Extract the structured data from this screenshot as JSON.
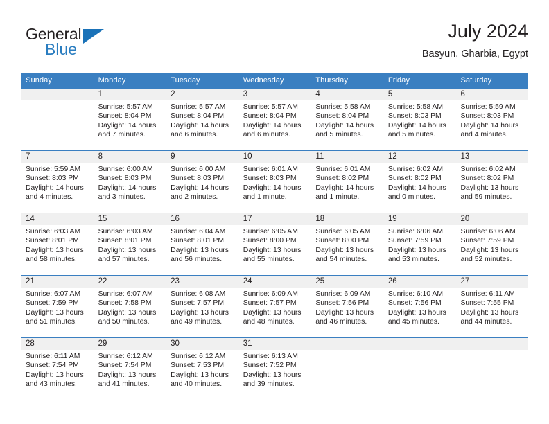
{
  "brand": {
    "name_part1": "General",
    "name_part2": "Blue",
    "triangle_color": "#1a72b8",
    "blue_color": "#2a7dc0"
  },
  "header": {
    "title": "July 2024",
    "subtitle": "Basyun, Gharbia, Egypt"
  },
  "theme": {
    "header_row_bg": "#3a7fc1",
    "date_band_bg": "#f0f0f0",
    "text_color": "#231f20"
  },
  "weekdays": [
    "Sunday",
    "Monday",
    "Tuesday",
    "Wednesday",
    "Thursday",
    "Friday",
    "Saturday"
  ],
  "weeks": [
    {
      "days": [
        {
          "date": "",
          "sunrise": "",
          "sunset": "",
          "daylight_line1": "",
          "daylight_line2": "",
          "empty": true
        },
        {
          "date": "1",
          "sunrise": "Sunrise: 5:57 AM",
          "sunset": "Sunset: 8:04 PM",
          "daylight_line1": "Daylight: 14 hours",
          "daylight_line2": "and 7 minutes."
        },
        {
          "date": "2",
          "sunrise": "Sunrise: 5:57 AM",
          "sunset": "Sunset: 8:04 PM",
          "daylight_line1": "Daylight: 14 hours",
          "daylight_line2": "and 6 minutes."
        },
        {
          "date": "3",
          "sunrise": "Sunrise: 5:57 AM",
          "sunset": "Sunset: 8:04 PM",
          "daylight_line1": "Daylight: 14 hours",
          "daylight_line2": "and 6 minutes."
        },
        {
          "date": "4",
          "sunrise": "Sunrise: 5:58 AM",
          "sunset": "Sunset: 8:04 PM",
          "daylight_line1": "Daylight: 14 hours",
          "daylight_line2": "and 5 minutes."
        },
        {
          "date": "5",
          "sunrise": "Sunrise: 5:58 AM",
          "sunset": "Sunset: 8:03 PM",
          "daylight_line1": "Daylight: 14 hours",
          "daylight_line2": "and 5 minutes."
        },
        {
          "date": "6",
          "sunrise": "Sunrise: 5:59 AM",
          "sunset": "Sunset: 8:03 PM",
          "daylight_line1": "Daylight: 14 hours",
          "daylight_line2": "and 4 minutes."
        }
      ]
    },
    {
      "days": [
        {
          "date": "7",
          "sunrise": "Sunrise: 5:59 AM",
          "sunset": "Sunset: 8:03 PM",
          "daylight_line1": "Daylight: 14 hours",
          "daylight_line2": "and 4 minutes."
        },
        {
          "date": "8",
          "sunrise": "Sunrise: 6:00 AM",
          "sunset": "Sunset: 8:03 PM",
          "daylight_line1": "Daylight: 14 hours",
          "daylight_line2": "and 3 minutes."
        },
        {
          "date": "9",
          "sunrise": "Sunrise: 6:00 AM",
          "sunset": "Sunset: 8:03 PM",
          "daylight_line1": "Daylight: 14 hours",
          "daylight_line2": "and 2 minutes."
        },
        {
          "date": "10",
          "sunrise": "Sunrise: 6:01 AM",
          "sunset": "Sunset: 8:03 PM",
          "daylight_line1": "Daylight: 14 hours",
          "daylight_line2": "and 1 minute."
        },
        {
          "date": "11",
          "sunrise": "Sunrise: 6:01 AM",
          "sunset": "Sunset: 8:02 PM",
          "daylight_line1": "Daylight: 14 hours",
          "daylight_line2": "and 1 minute."
        },
        {
          "date": "12",
          "sunrise": "Sunrise: 6:02 AM",
          "sunset": "Sunset: 8:02 PM",
          "daylight_line1": "Daylight: 14 hours",
          "daylight_line2": "and 0 minutes."
        },
        {
          "date": "13",
          "sunrise": "Sunrise: 6:02 AM",
          "sunset": "Sunset: 8:02 PM",
          "daylight_line1": "Daylight: 13 hours",
          "daylight_line2": "and 59 minutes."
        }
      ]
    },
    {
      "days": [
        {
          "date": "14",
          "sunrise": "Sunrise: 6:03 AM",
          "sunset": "Sunset: 8:01 PM",
          "daylight_line1": "Daylight: 13 hours",
          "daylight_line2": "and 58 minutes."
        },
        {
          "date": "15",
          "sunrise": "Sunrise: 6:03 AM",
          "sunset": "Sunset: 8:01 PM",
          "daylight_line1": "Daylight: 13 hours",
          "daylight_line2": "and 57 minutes."
        },
        {
          "date": "16",
          "sunrise": "Sunrise: 6:04 AM",
          "sunset": "Sunset: 8:01 PM",
          "daylight_line1": "Daylight: 13 hours",
          "daylight_line2": "and 56 minutes."
        },
        {
          "date": "17",
          "sunrise": "Sunrise: 6:05 AM",
          "sunset": "Sunset: 8:00 PM",
          "daylight_line1": "Daylight: 13 hours",
          "daylight_line2": "and 55 minutes."
        },
        {
          "date": "18",
          "sunrise": "Sunrise: 6:05 AM",
          "sunset": "Sunset: 8:00 PM",
          "daylight_line1": "Daylight: 13 hours",
          "daylight_line2": "and 54 minutes."
        },
        {
          "date": "19",
          "sunrise": "Sunrise: 6:06 AM",
          "sunset": "Sunset: 7:59 PM",
          "daylight_line1": "Daylight: 13 hours",
          "daylight_line2": "and 53 minutes."
        },
        {
          "date": "20",
          "sunrise": "Sunrise: 6:06 AM",
          "sunset": "Sunset: 7:59 PM",
          "daylight_line1": "Daylight: 13 hours",
          "daylight_line2": "and 52 minutes."
        }
      ]
    },
    {
      "days": [
        {
          "date": "21",
          "sunrise": "Sunrise: 6:07 AM",
          "sunset": "Sunset: 7:59 PM",
          "daylight_line1": "Daylight: 13 hours",
          "daylight_line2": "and 51 minutes."
        },
        {
          "date": "22",
          "sunrise": "Sunrise: 6:07 AM",
          "sunset": "Sunset: 7:58 PM",
          "daylight_line1": "Daylight: 13 hours",
          "daylight_line2": "and 50 minutes."
        },
        {
          "date": "23",
          "sunrise": "Sunrise: 6:08 AM",
          "sunset": "Sunset: 7:57 PM",
          "daylight_line1": "Daylight: 13 hours",
          "daylight_line2": "and 49 minutes."
        },
        {
          "date": "24",
          "sunrise": "Sunrise: 6:09 AM",
          "sunset": "Sunset: 7:57 PM",
          "daylight_line1": "Daylight: 13 hours",
          "daylight_line2": "and 48 minutes."
        },
        {
          "date": "25",
          "sunrise": "Sunrise: 6:09 AM",
          "sunset": "Sunset: 7:56 PM",
          "daylight_line1": "Daylight: 13 hours",
          "daylight_line2": "and 46 minutes."
        },
        {
          "date": "26",
          "sunrise": "Sunrise: 6:10 AM",
          "sunset": "Sunset: 7:56 PM",
          "daylight_line1": "Daylight: 13 hours",
          "daylight_line2": "and 45 minutes."
        },
        {
          "date": "27",
          "sunrise": "Sunrise: 6:11 AM",
          "sunset": "Sunset: 7:55 PM",
          "daylight_line1": "Daylight: 13 hours",
          "daylight_line2": "and 44 minutes."
        }
      ]
    },
    {
      "days": [
        {
          "date": "28",
          "sunrise": "Sunrise: 6:11 AM",
          "sunset": "Sunset: 7:54 PM",
          "daylight_line1": "Daylight: 13 hours",
          "daylight_line2": "and 43 minutes."
        },
        {
          "date": "29",
          "sunrise": "Sunrise: 6:12 AM",
          "sunset": "Sunset: 7:54 PM",
          "daylight_line1": "Daylight: 13 hours",
          "daylight_line2": "and 41 minutes."
        },
        {
          "date": "30",
          "sunrise": "Sunrise: 6:12 AM",
          "sunset": "Sunset: 7:53 PM",
          "daylight_line1": "Daylight: 13 hours",
          "daylight_line2": "and 40 minutes."
        },
        {
          "date": "31",
          "sunrise": "Sunrise: 6:13 AM",
          "sunset": "Sunset: 7:52 PM",
          "daylight_line1": "Daylight: 13 hours",
          "daylight_line2": "and 39 minutes."
        },
        {
          "date": "",
          "sunrise": "",
          "sunset": "",
          "daylight_line1": "",
          "daylight_line2": "",
          "empty": true
        },
        {
          "date": "",
          "sunrise": "",
          "sunset": "",
          "daylight_line1": "",
          "daylight_line2": "",
          "empty": true
        },
        {
          "date": "",
          "sunrise": "",
          "sunset": "",
          "daylight_line1": "",
          "daylight_line2": "",
          "empty": true
        }
      ]
    }
  ]
}
